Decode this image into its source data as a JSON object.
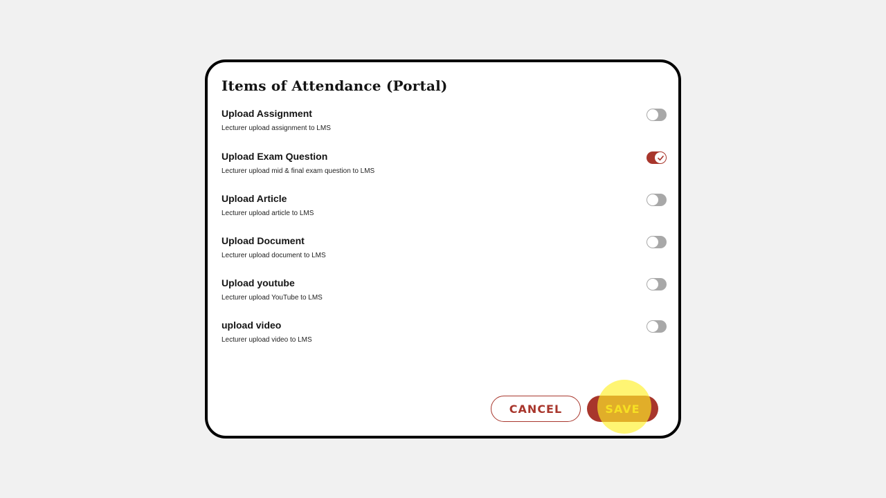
{
  "modal": {
    "title": "Items of Attendance (Portal)",
    "items": [
      {
        "label": "Upload Assignment",
        "description": "Lecturer upload assignment to LMS",
        "enabled": false
      },
      {
        "label": "Upload Exam Question",
        "description": "Lecturer upload mid & final exam question to LMS",
        "enabled": true
      },
      {
        "label": "Upload Article",
        "description": "Lecturer upload article to LMS",
        "enabled": false
      },
      {
        "label": "Upload Document",
        "description": "Lecturer upload document to LMS",
        "enabled": false
      },
      {
        "label": "Upload youtube",
        "description": "Lecturer upload YouTube to LMS",
        "enabled": false
      },
      {
        "label": "upload video",
        "description": "Lecturer upload video to LMS",
        "enabled": false
      }
    ],
    "cancel_label": "CANCEL",
    "save_label": "SAVE"
  },
  "colors": {
    "accent": "#a8362c",
    "toggle_off": "#a8a8a8",
    "save_text": "#e8c21a",
    "cursor_highlight": "#fff028"
  },
  "icons": {
    "toggle_on": "check-icon"
  }
}
